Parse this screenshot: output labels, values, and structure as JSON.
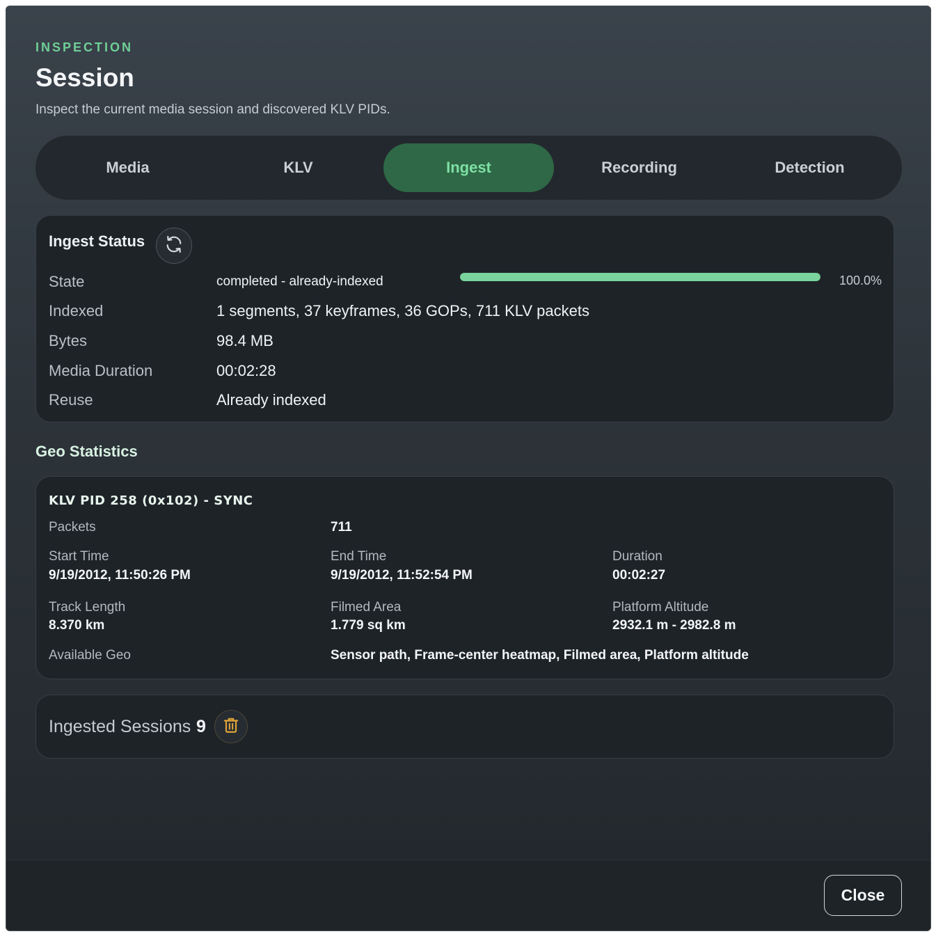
{
  "header": {
    "eyebrow": "INSPECTION",
    "title": "Session",
    "subtitle": "Inspect the current media session and discovered KLV PIDs."
  },
  "tabs": [
    {
      "label": "Media",
      "active": false
    },
    {
      "label": "KLV",
      "active": false
    },
    {
      "label": "Ingest",
      "active": true
    },
    {
      "label": "Recording",
      "active": false
    },
    {
      "label": "Detection",
      "active": false
    }
  ],
  "ingest_status": {
    "title": "Ingest Status",
    "refresh_icon": "refresh-icon",
    "rows": [
      {
        "label": "State",
        "value": "completed - already-indexed"
      },
      {
        "label": "Indexed",
        "value": "1 segments, 37 keyframes, 36 GOPs, 711 KLV packets"
      },
      {
        "label": "Bytes",
        "value": "98.4 MB"
      },
      {
        "label": "Media Duration",
        "value": "00:02:28"
      },
      {
        "label": "Reuse",
        "value": "Already indexed"
      }
    ],
    "progress_fraction": 1.0,
    "progress_text": "100.0%"
  },
  "geo": {
    "section_title": "Geo Statistics",
    "pid_title": "KLV PID 258 (0x102) - SYNC",
    "packets_label": "Packets",
    "packets_value": "711",
    "start_time_label": "Start Time",
    "start_time_value": "9/19/2012, 11:50:26 PM",
    "end_time_label": "End Time",
    "end_time_value": "9/19/2012, 11:52:54 PM",
    "duration_label": "Duration",
    "duration_value": "00:02:27",
    "track_length_label": "Track Length",
    "track_length_value": "8.370 km",
    "filmed_area_label": "Filmed Area",
    "filmed_area_value": "1.779 sq km",
    "altitude_label": "Platform Altitude",
    "altitude_value": "2932.1 m - 2982.8 m",
    "available_geo_label": "Available Geo",
    "available_geo_value": "Sensor path, Frame-center heatmap, Filmed area, Platform altitude"
  },
  "sessions": {
    "label": "Ingested Sessions",
    "count": "9",
    "delete_icon": "trash-icon"
  },
  "footer": {
    "close_label": "Close"
  },
  "colors": {
    "accent_green": "#6fcf97",
    "active_tab_bg": "#2f6846",
    "progress": "#79d39c",
    "trash": "#e0a33a"
  }
}
